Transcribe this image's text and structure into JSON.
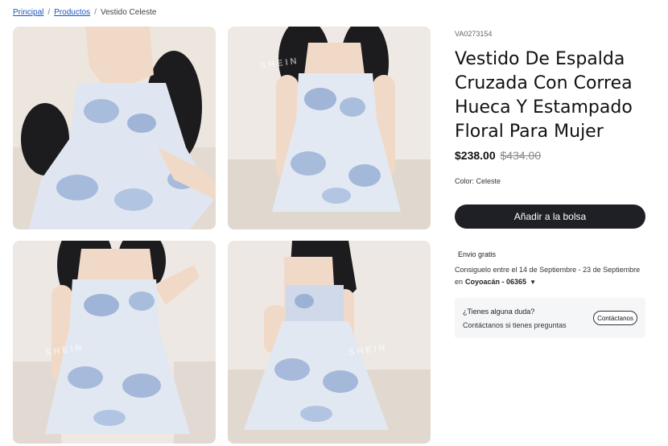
{
  "breadcrumb": {
    "home": "Principal",
    "products": "Productos",
    "current": "Vestido Celeste",
    "sep": "/"
  },
  "product": {
    "sku": "VA0273154",
    "title": "Vestido De Espalda Cruzada Con Correa Hueca Y Estampado Floral Para Mujer",
    "price": "$238.00",
    "old_price": "$434.00",
    "color_label": "Color: Celeste",
    "add_to_bag": "Añadir a la bolsa"
  },
  "shipping": {
    "title": "Envio gratis",
    "text": "Consiguelo entre el 14 de Septiembre - 23 de Septiembre en",
    "location": "Coyoacán - 06365"
  },
  "help": {
    "question": "¿Tienes alguna duda?",
    "subtitle": "Contáctanos si tienes preguntas",
    "contact_button": "Contáctanos"
  },
  "gallery": {
    "watermark": "SHEIN"
  },
  "colors": {
    "button_dark": "#1f2025",
    "link": "#1a56c4",
    "dress_blue": "#8fa8d0",
    "wall": "#ede8e3"
  }
}
